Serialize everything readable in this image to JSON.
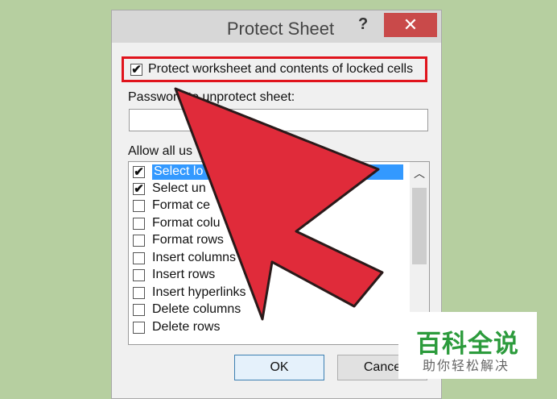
{
  "dialog": {
    "title": "Protect Sheet",
    "help_glyph": "?",
    "close_glyph": "✕",
    "protect_checkbox": {
      "label": "Protect worksheet and contents of locked cells",
      "checked": true
    },
    "password_label": "Password to unprotect sheet:",
    "password_value": "",
    "allow_label": "Allow all us",
    "permissions": [
      {
        "label": "Select lo",
        "checked": true,
        "selected": true
      },
      {
        "label": "Select un",
        "checked": true,
        "selected": false
      },
      {
        "label": "Format ce",
        "checked": false,
        "selected": false
      },
      {
        "label": "Format colu",
        "checked": false,
        "selected": false
      },
      {
        "label": "Format rows",
        "checked": false,
        "selected": false
      },
      {
        "label": "Insert columns",
        "checked": false,
        "selected": false
      },
      {
        "label": "Insert rows",
        "checked": false,
        "selected": false
      },
      {
        "label": "Insert hyperlinks",
        "checked": false,
        "selected": false
      },
      {
        "label": "Delete columns",
        "checked": false,
        "selected": false
      },
      {
        "label": "Delete rows",
        "checked": false,
        "selected": false
      }
    ],
    "ok_label": "OK",
    "cancel_label": "Cance"
  },
  "colors": {
    "arrow": "#e02b3a",
    "highlight_box": "#e0141c",
    "watermark_green": "#2c9b3c"
  },
  "watermark": {
    "title": "百科全说",
    "subtitle": "助你轻松解决"
  }
}
